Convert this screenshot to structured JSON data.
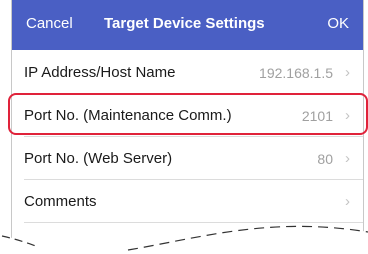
{
  "navbar": {
    "cancel_label": "Cancel",
    "title": "Target Device Settings",
    "ok_label": "OK"
  },
  "settings": [
    {
      "label": "IP Address/Host Name",
      "value": "192.168.1.5"
    },
    {
      "label": "Port No. (Maintenance Comm.)",
      "value": "2101"
    },
    {
      "label": "Port No. (Web Server)",
      "value": "80"
    },
    {
      "label": "Comments",
      "value": ""
    }
  ],
  "chevron_icon": "chevron-right-icon",
  "colors": {
    "navbar": "#4a5fc4",
    "highlight": "#e0223a"
  }
}
